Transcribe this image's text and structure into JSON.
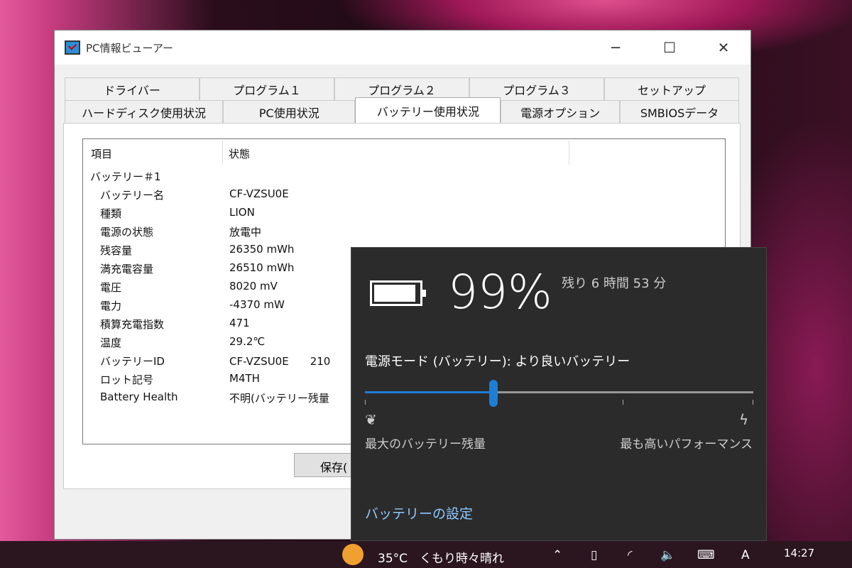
{
  "window": {
    "title": "PC情報ビューアー",
    "minimize": "─",
    "maximize": "☐",
    "close": "✕"
  },
  "tabs_row1": [
    "ドライバー",
    "プログラム１",
    "プログラム２",
    "プログラム３",
    "セットアップ"
  ],
  "tabs_row2": [
    "ハードディスク使用状況",
    "PC使用状況",
    "バッテリー使用状況",
    "電源オプション",
    "SMBIOSデータ"
  ],
  "active_tab": "バッテリー使用状況",
  "list": {
    "headers": [
      "項目",
      "状態"
    ],
    "group": "バッテリー＃1",
    "rows": [
      [
        "バッテリー名",
        "CF-VZSU0E"
      ],
      [
        "種類",
        "LION"
      ],
      [
        "電源の状態",
        "放電中"
      ],
      [
        "残容量",
        "26350 mWh"
      ],
      [
        "満充電容量",
        "26510 mWh"
      ],
      [
        "電圧",
        "8020 mV"
      ],
      [
        "電力",
        "-4370 mW"
      ],
      [
        "積算充電指数",
        "471"
      ],
      [
        "温度",
        "29.2℃"
      ],
      [
        "バッテリーID",
        "CF-VZSU0E　　210"
      ],
      [
        "ロット記号",
        "M4TH"
      ],
      [
        "Battery Health",
        "不明(バッテリー残量"
      ]
    ]
  },
  "save_button": "保存(",
  "flyout": {
    "percent": "99%",
    "remaining": "残り 6 時間 53 分",
    "mode_label": "電源モード (バッテリー): より良いバッテリー",
    "slider_value_percent": 33,
    "left_label": "最大のバッテリー残量",
    "right_label": "最も高いパフォーマンス",
    "settings_link": "バッテリーの設定"
  },
  "taskbar": {
    "weather": "35°C　くもり時々晴れ",
    "time": "14:27",
    "ime": "A"
  }
}
